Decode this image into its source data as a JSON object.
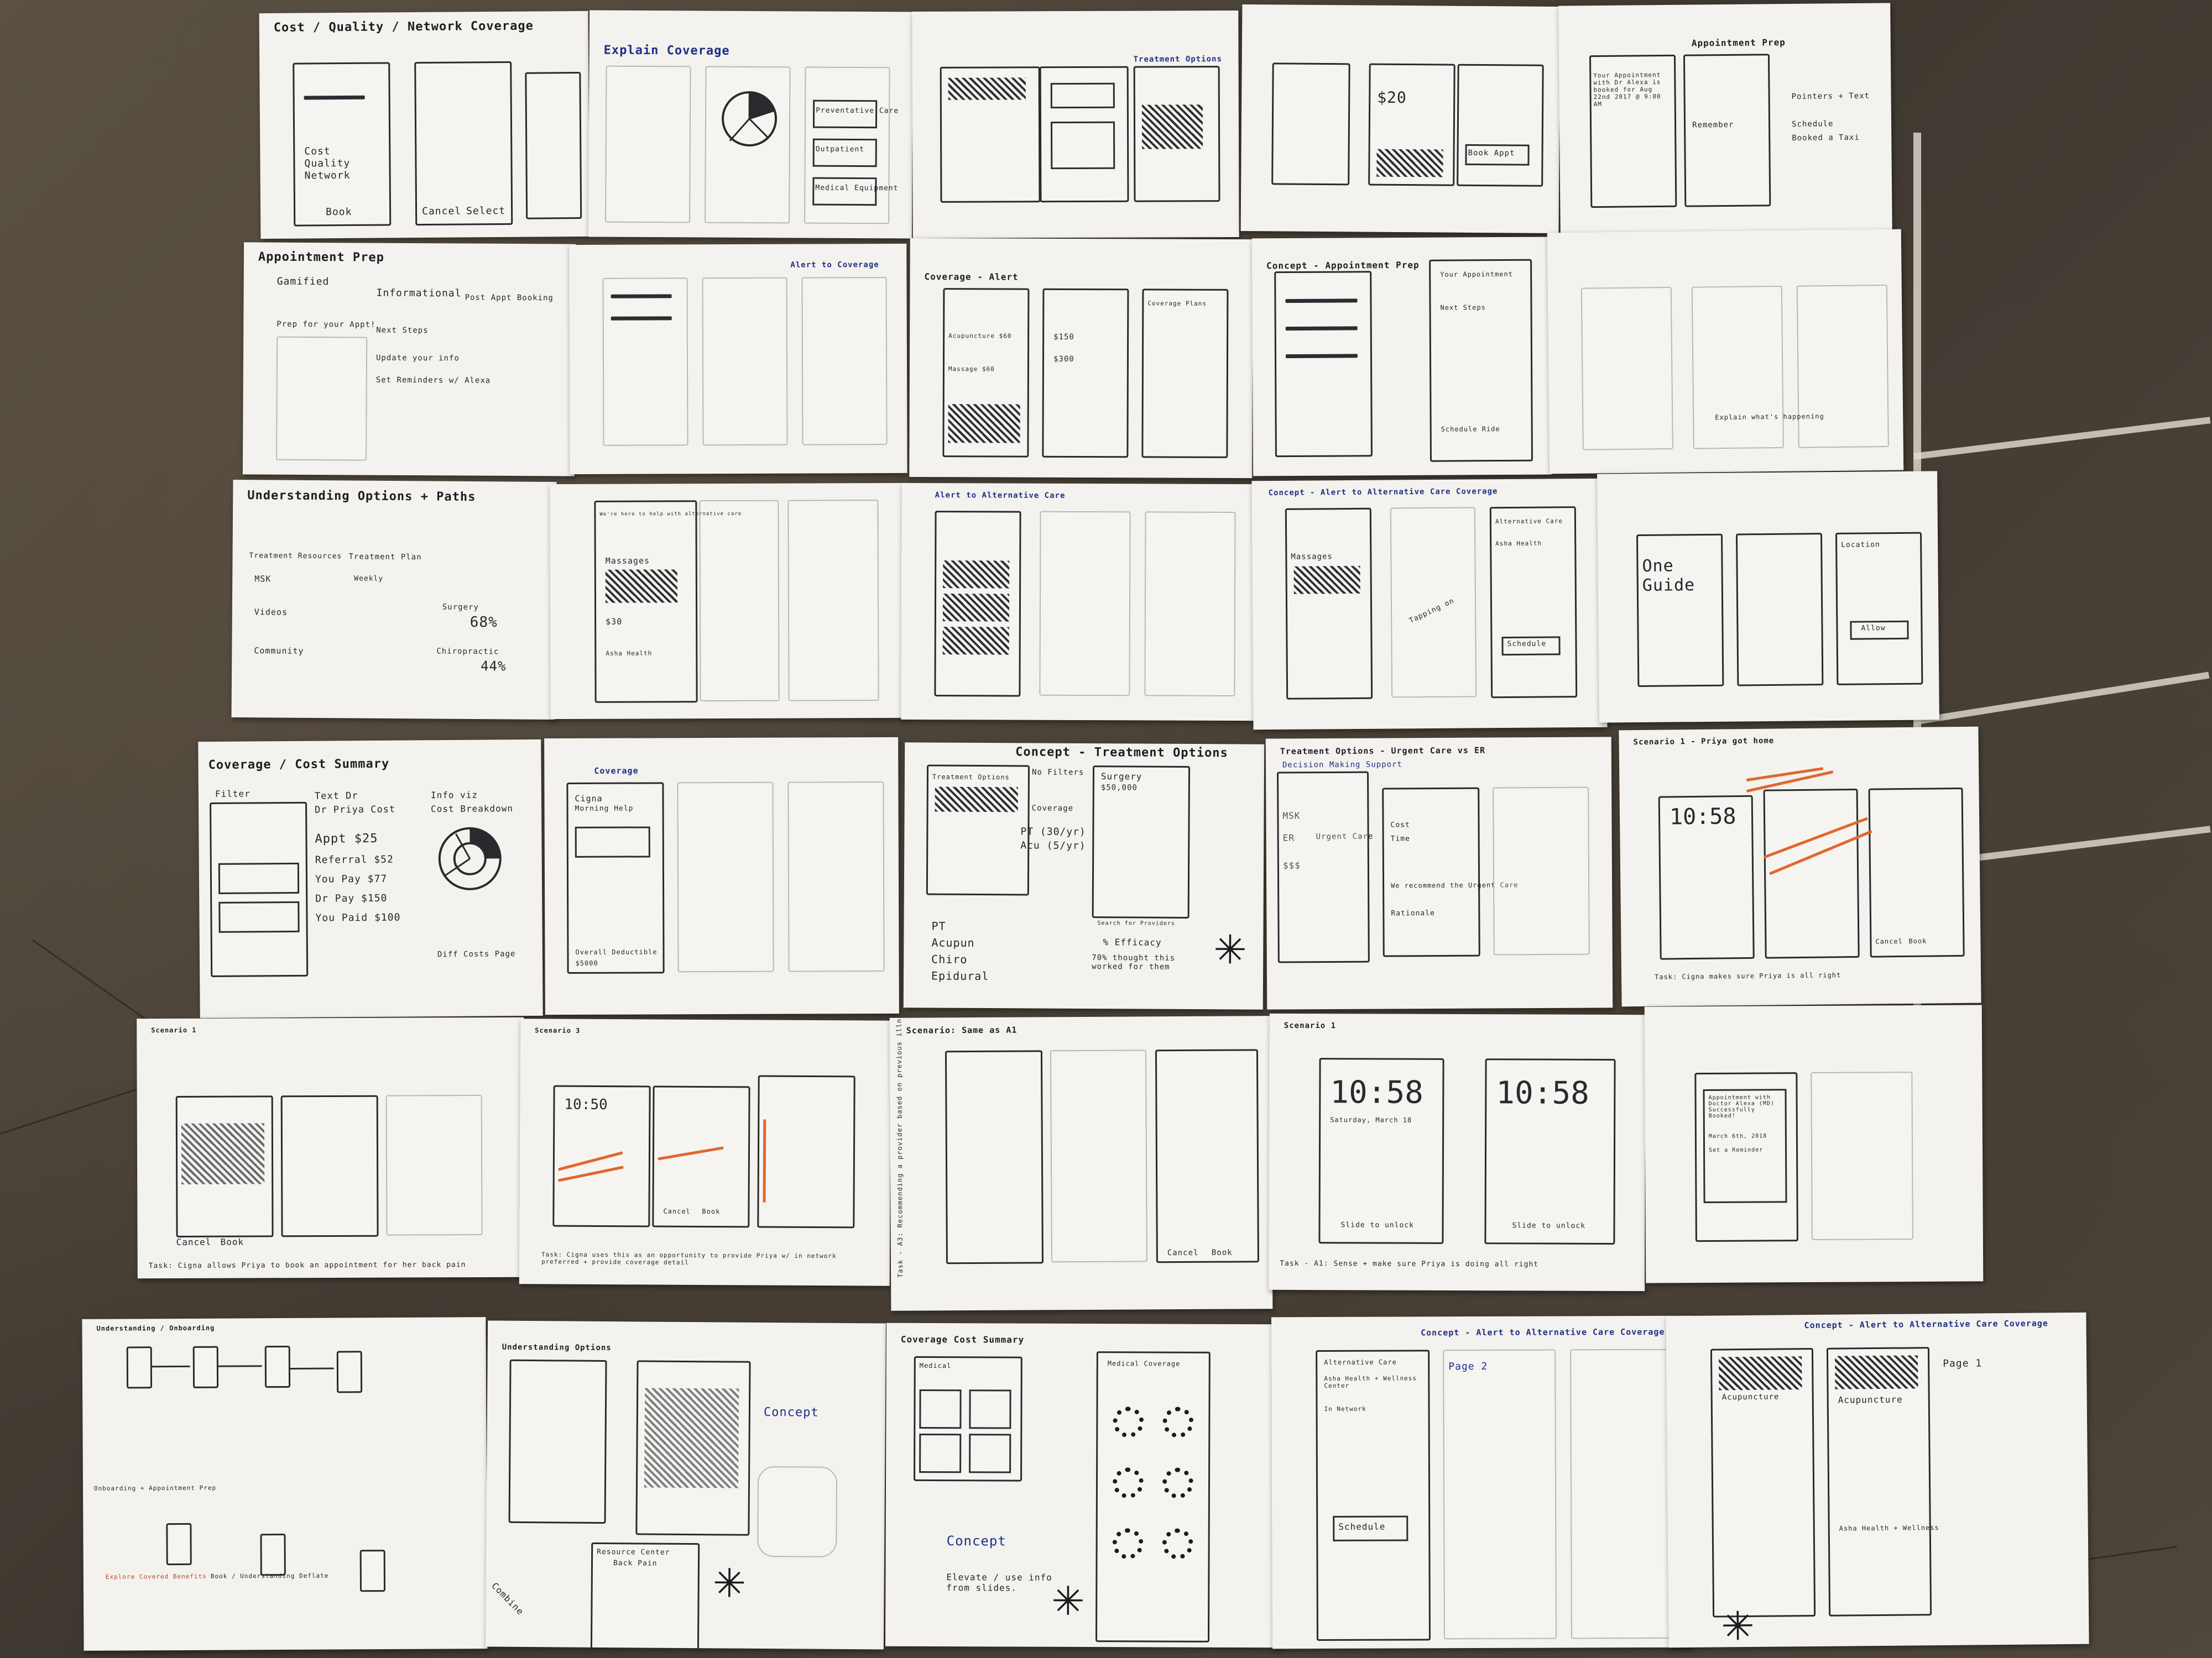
{
  "scene": "sketch-wall",
  "colors": {
    "floor": "#4a4238",
    "paper": "#f3f2ee",
    "ink": "#2a2a2e",
    "blue_ink": "#1e2f86",
    "orange_marker": "#e0672e"
  },
  "sheets": [
    {
      "title": "Cost / Quality / Network Coverage",
      "notes": [
        "Cost",
        "Quality",
        "Network",
        "Book",
        "Cancel",
        "Select"
      ]
    },
    {
      "title": "Explain Coverage",
      "notes": [
        "Preventative Care",
        "Outpatient",
        "Medical Equipment"
      ]
    },
    {
      "title": "",
      "notes": [
        "Treatment Options"
      ]
    },
    {
      "title": "",
      "notes": [
        "$20",
        "Book Appt"
      ]
    },
    {
      "title": "Appointment Prep",
      "notes": [
        "Your Appointment with Dr Alexa is booked for Aug 22nd 2017 @ 9:00 AM",
        "Remember",
        "Pointers + Text",
        "Schedule",
        "Booked a Taxi"
      ]
    },
    {
      "title": "Appointment Prep",
      "notes": [
        "Gamified",
        "Informational",
        "Prep for your Appt!",
        "Next Steps",
        "Update your info",
        "Set Reminders w/ Alexa",
        "Post Appt Booking"
      ]
    },
    {
      "title": "",
      "notes": [
        "Alert to Coverage"
      ]
    },
    {
      "title": "Coverage - Alert",
      "notes": [
        "Acupuncture $60",
        "Massage $60",
        "$150",
        "$300",
        "Coverage Plans"
      ]
    },
    {
      "title": "Concept - Appointment Prep",
      "notes": [
        "Your Appointment",
        "Next Steps",
        "Schedule Ride"
      ]
    },
    {
      "title": "",
      "notes": [
        "Explain what's happening"
      ]
    },
    {
      "title": "Understanding Options + Paths",
      "notes": [
        "Treatment Resources",
        "MSK",
        "Videos",
        "Community",
        "Treatment Plan",
        "Weekly",
        "Surgery",
        "68%",
        "Chiropractic",
        "44%"
      ]
    },
    {
      "title": "",
      "notes": [
        "We're here to help with alternative care",
        "Massages",
        "$30",
        "Asha Health"
      ]
    },
    {
      "title": "Alert to Alternative Care",
      "notes": []
    },
    {
      "title": "Concept - Alert to Alternative Care Coverage",
      "notes": [
        "Massages",
        "Alternative Care",
        "Asha Health",
        "Schedule",
        "Tapping on"
      ]
    },
    {
      "title": "",
      "notes": [
        "One Guide",
        "Location",
        "Allow"
      ]
    },
    {
      "title": "Coverage / Cost Summary",
      "notes": [
        "Filter",
        "Text Dr",
        "Dr Priya Cost",
        "Appt $25",
        "Referral $52",
        "You Pay $77",
        "Dr Pay $150",
        "You Paid $100",
        "Info viz",
        "Cost Breakdown",
        "Diff Costs Page"
      ]
    },
    {
      "title": "Coverage",
      "notes": [
        "Cigna",
        "Morning Help",
        "Overall Deductible",
        "$5000"
      ]
    },
    {
      "title": "Concept - Treatment Options",
      "notes": [
        "Treatment Options",
        "No Filters",
        "Coverage",
        "PT (30/yr)",
        "Acu (5/yr)",
        "PT",
        "Acupun",
        "Chiro",
        "Epidural",
        "Surgery",
        "$50,000",
        "% Efficacy",
        "70% thought this worked for them",
        "Search for Providers"
      ]
    },
    {
      "title": "Treatment Options - Urgent Care vs ER",
      "notes": [
        "Decision Making Support",
        "MSK",
        "ER",
        "Urgent Care",
        "$$$",
        "Cost",
        "Time",
        "We recommend the Urgent Care",
        "Rationale"
      ]
    },
    {
      "title": "Scenario 1 - Priya got home",
      "notes": [
        "10:58",
        "Cancel",
        "Book",
        "Task: Cigna makes sure Priya is all right"
      ]
    },
    {
      "title": "Scenario 1",
      "notes": [
        "Cancel",
        "Book",
        "Task: Cigna allows Priya to book an appointment for her back pain"
      ]
    },
    {
      "title": "Scenario 3",
      "notes": [
        "10:50",
        "Cancel",
        "Book",
        "Task: Cigna uses this as an opportunity to provide Priya w/ in network preferred + provide coverage detail"
      ]
    },
    {
      "title": "Scenario: Same as A1",
      "notes": [
        "Cancel",
        "Book",
        "Task - A3: Recommending a provider based on previous illness"
      ]
    },
    {
      "title": "Scenario 1",
      "notes": [
        "10:58",
        "10:58",
        "Saturday, March 18",
        "Slide to unlock",
        "Task - A1: Sense + make sure Priya is doing all right"
      ]
    },
    {
      "title": "",
      "notes": [
        "Appointment with Doctor Alexa (MD) Successfully Booked!",
        "March 6th, 2018",
        "Set a Reminder"
      ]
    },
    {
      "title": "Understanding / Onboarding",
      "notes": [
        "Onboarding + Appointment Prep",
        "Explore Covered Benefits",
        "Book / Understanding Deflate"
      ]
    },
    {
      "title": "Understanding Options",
      "notes": [
        "Resource Center",
        "Back Pain",
        "Concept",
        "Combine"
      ]
    },
    {
      "title": "Coverage Cost Summary",
      "notes": [
        "Medical",
        "Medical Coverage",
        "Concept",
        "Elevate / use info from slides."
      ]
    },
    {
      "title": "Concept - Alert to Alternative Care Coverage",
      "notes": [
        "Alternative Care",
        "Asha Health + Wellness Center",
        "In Network",
        "Schedule",
        "Page 2"
      ]
    },
    {
      "title": "Concept - Alert to Alternative Care Coverage",
      "notes": [
        "Acupuncture",
        "Page 1",
        "Asha Health + Wellness"
      ]
    }
  ]
}
